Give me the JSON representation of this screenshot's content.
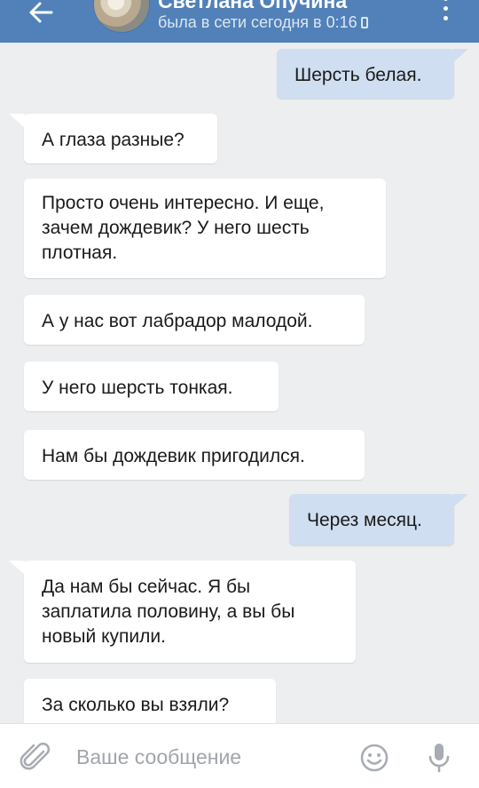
{
  "header": {
    "title": "Светлана Опучина",
    "status": "была в сети сегодня в 0:16"
  },
  "messages": [
    {
      "dir": "out",
      "text": "Шерсть белая."
    },
    {
      "dir": "in",
      "text": "А глаза разные?"
    },
    {
      "dir": "in",
      "text": "Просто очень интересно. И еще, зачем дождевик? У него шесть плотная."
    },
    {
      "dir": "in",
      "text": "А у нас вот лабрадор малодой."
    },
    {
      "dir": "in",
      "text": "У него шерсть тонкая."
    },
    {
      "dir": "in",
      "text": "Нам бы дождевик пригодился."
    },
    {
      "dir": "out",
      "text": "Через месяц."
    },
    {
      "dir": "in",
      "text": "Да нам бы сейчас. Я бы заплатила половину, а вы бы новый купили."
    },
    {
      "dir": "in",
      "text": "За сколько вы взяли?"
    }
  ],
  "composer": {
    "placeholder": "Ваше сообщение"
  },
  "icons": {
    "back": "arrow-left-icon",
    "menu": "more-vertical-icon",
    "status": "phone-icon",
    "attach": "paperclip-icon",
    "emoji": "smiley-icon",
    "mic": "microphone-icon"
  },
  "colors": {
    "header": "#5181b8",
    "background": "#edeef0",
    "incoming_bubble": "#ffffff",
    "outgoing_bubble": "#cfdef0",
    "text": "#1a1a1a",
    "placeholder": "#a0a5ab",
    "icon": "#a8adb3"
  }
}
